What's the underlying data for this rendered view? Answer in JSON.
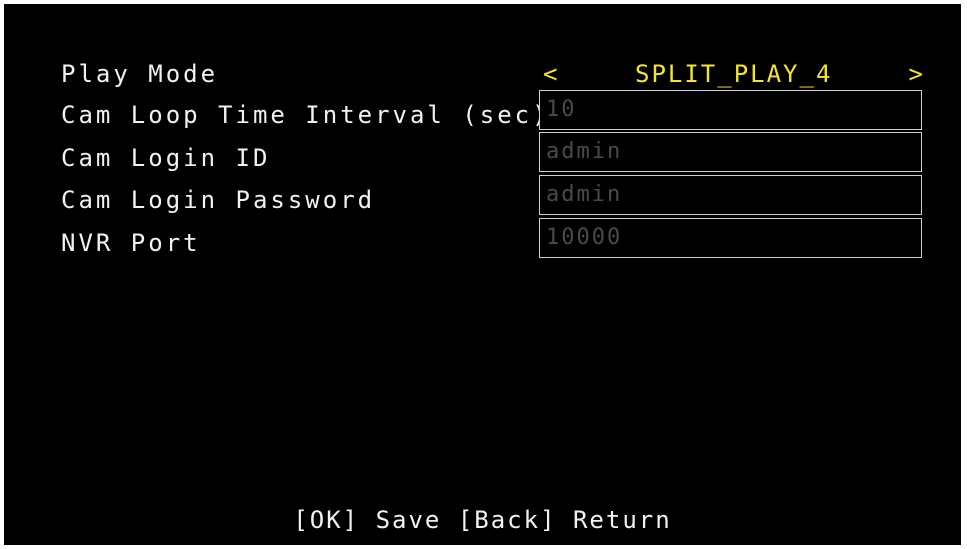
{
  "settings": {
    "play_mode": {
      "label": "Play Mode",
      "value": "SPLIT_PLAY_4",
      "prev_symbol": "<",
      "next_symbol": ">"
    },
    "loop_interval": {
      "label": "Cam Loop Time Interval (sec)",
      "value": "10"
    },
    "login_id": {
      "label": "Cam Login ID",
      "value": "admin"
    },
    "login_password": {
      "label": "Cam Login Password",
      "value": "admin"
    },
    "nvr_port": {
      "label": "NVR Port",
      "value": "10000"
    }
  },
  "footer": {
    "hint": "[OK] Save [Back] Return"
  },
  "colors": {
    "background": "#000000",
    "text": "#f2f2f2",
    "selector_accent": "#f5e42e",
    "field_border": "#cfcfcf",
    "field_text": "#4a4a4a"
  }
}
